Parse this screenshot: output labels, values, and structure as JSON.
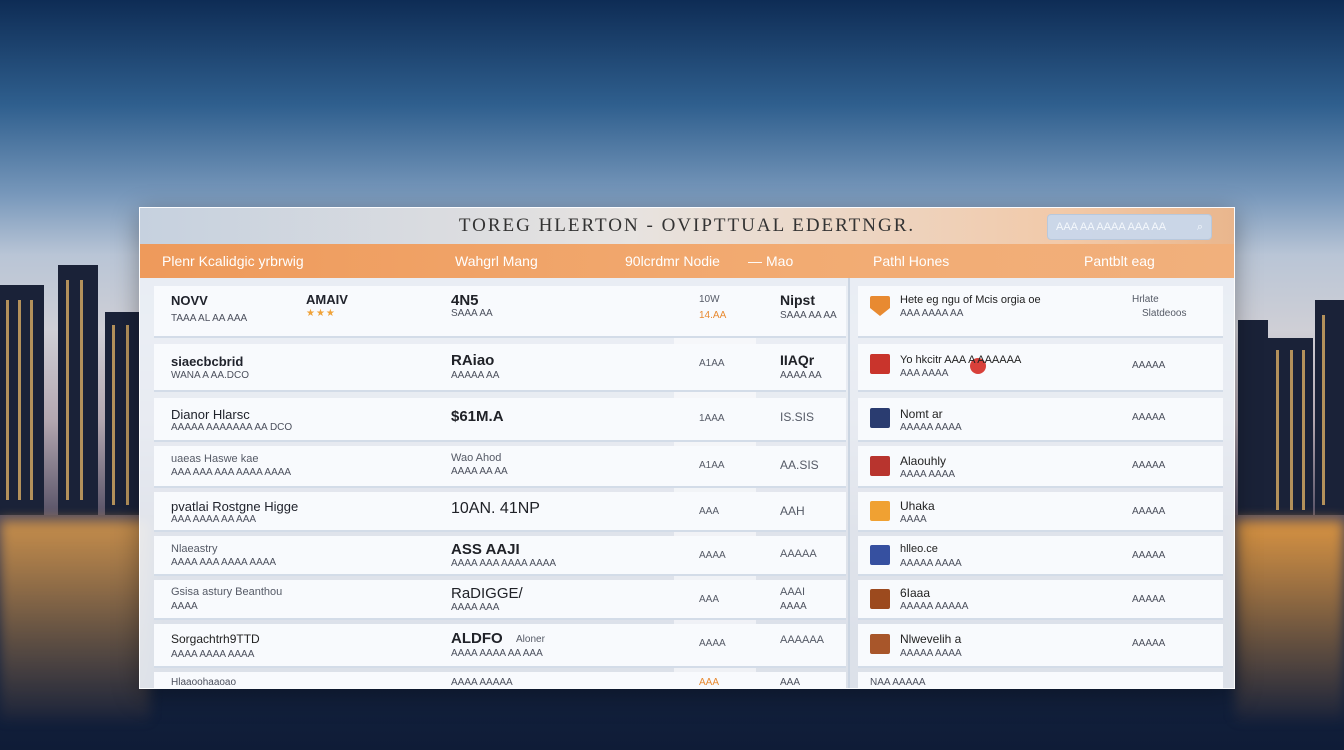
{
  "window": {
    "title": "TOREG HLERTON - OVIPTTUAL EDERTNGR.",
    "search_placeholder": "AAA AA AAAA AAA AA"
  },
  "headers": {
    "col1": "Plenr Kcalidgic yrbrwig",
    "col2": "Wahgrl Mang",
    "col3": "90lcrdmr Nodie",
    "col3_sep": "—",
    "col4": "Mao",
    "col5": "Pathl Hones",
    "col6": "Pantblt eag"
  },
  "rows": [
    {
      "name": "NOVV",
      "sub": "TAAA AL AA AAA",
      "brand": "AMAIV",
      "stars": "★★★",
      "price": "4N5",
      "price_sub": "SAAA AA",
      "qty": "10W",
      "qty_sub": "14.AA",
      "qty_orange": true,
      "tag": "Nipst",
      "tag_sub": "SAAA AA AA"
    },
    {
      "name": "siaecbcbrid",
      "sub": "WANA A AA.DCO",
      "brand": "",
      "stars": "",
      "price": "RAiao",
      "price_sub": "AAAAA AA",
      "qty": "A1AA",
      "qty_sub": "",
      "qty_orange": false,
      "tag": "IIAQr",
      "tag_sub": "AAAA AA"
    },
    {
      "name": "Dianor   Hlarsc",
      "sub": "AAAAA AAAAAAA AA DCO",
      "brand": "",
      "stars": "",
      "price": "$61M.A",
      "price_sub": "",
      "qty": "1AAA",
      "qty_sub": "",
      "qty_orange": false,
      "tag": "IS.SIS",
      "tag_sub": ""
    },
    {
      "name": "uaeas  Haswe kae",
      "sub": "AAA AAA AAA AAAA AAAA",
      "brand": "",
      "stars": "",
      "price": "Wao Ahod",
      "price_sub": "AAAA AA AA",
      "qty": "A1AA",
      "qty_sub": "",
      "qty_orange": false,
      "tag": "AA.SIS",
      "tag_sub": ""
    },
    {
      "name": "pvatlai Rostgne Higge",
      "sub": "AAA AAAA AA AAA",
      "brand": "",
      "stars": "",
      "price": "10AN. 41NP",
      "price_sub": "",
      "qty": "AAA",
      "qty_sub": "",
      "qty_orange": false,
      "tag": "AAH",
      "tag_sub": ""
    },
    {
      "name": "Nlaeastry",
      "sub": "AAAA AAA AAAA  AAAA",
      "brand": "",
      "stars": "",
      "price": "ASS AAJI",
      "price_sub": "AAAA AAA AAAA AAAA",
      "qty": "AAAA",
      "qty_sub": "",
      "qty_orange": false,
      "tag": "AAAAA",
      "tag_sub": ""
    },
    {
      "name": "Gsisa astury Beanthou",
      "sub": "AAAA",
      "brand": "",
      "stars": "",
      "price": "RaDIGGE/",
      "price_sub": "AAAA AAA",
      "qty": "AAA",
      "qty_sub": "",
      "qty_orange": false,
      "tag": "AAAI",
      "tag_sub": "AAAA"
    },
    {
      "name": "Sorgachtrh9TTD",
      "sub": "AAAA AAAA AAAA",
      "brand": "",
      "stars": "",
      "price": "ALDFO",
      "price_sub": "AAAA AAAA AA AAA",
      "qty": "AAAA",
      "qty_sub": "",
      "qty_orange": false,
      "tag": "AAAAAA",
      "tag_sub": "",
      "price_extra": "Aloner"
    },
    {
      "name": "Hlaaoohaaoao",
      "sub": "",
      "brand": "",
      "stars": "",
      "price": "AAAA AAAAA",
      "price_sub": "",
      "qty": "AAA",
      "qty_sub": "",
      "qty_orange": true,
      "tag": "AAA",
      "tag_sub": ""
    }
  ],
  "hotels": [
    {
      "icon": "hotel-thumb-orange",
      "name": "Hete eg ngu of Mcis orgia oe",
      "sub": "AAA AAAA AA",
      "action": "Hrlate",
      "action_sub": "Slatdeoos",
      "color": "#e88a31"
    },
    {
      "icon": "hotel-thumb-red",
      "name": "Yo hkcitr    AAA  A AAAAAA",
      "sub": "AAA AAAA",
      "action": "AAAAA",
      "action_sub": "",
      "color": "#c9342c"
    },
    {
      "icon": "hotel-thumb-navy",
      "name": "Nomt ar",
      "sub": "AAAAA AAAA",
      "action": "AAAAA",
      "action_sub": "",
      "color": "#2a3c70"
    },
    {
      "icon": "hotel-thumb-red",
      "name": "Alaouhly",
      "sub": "AAAA AAAA",
      "action": "AAAAA",
      "action_sub": "",
      "color": "#b8342e"
    },
    {
      "icon": "hotel-thumb-amber",
      "name": "Uhaka",
      "sub": "AAAA",
      "action": "AAAAA",
      "action_sub": "",
      "color": "#f0a132"
    },
    {
      "icon": "hotel-thumb-blue",
      "name": "hlleo.ce",
      "sub": "AAAAA AAAA",
      "action": "AAAAA",
      "action_sub": "",
      "color": "#3650a0"
    },
    {
      "icon": "hotel-thumb-brown",
      "name": "6Iaaa",
      "sub": "AAAAA AAAAA",
      "action": "AAAAA",
      "action_sub": "",
      "color": "#9c4a1e"
    },
    {
      "icon": "hotel-thumb-brown",
      "name": "Nlwevelih a",
      "sub": "AAAAA AAAA",
      "action": "AAAAA",
      "action_sub": "",
      "color": "#a8562a"
    },
    {
      "icon": "hotel-thumb-brown",
      "name": "NAA AAAAA",
      "sub": "",
      "action": "",
      "action_sub": "",
      "color": "#8a4a26"
    }
  ]
}
